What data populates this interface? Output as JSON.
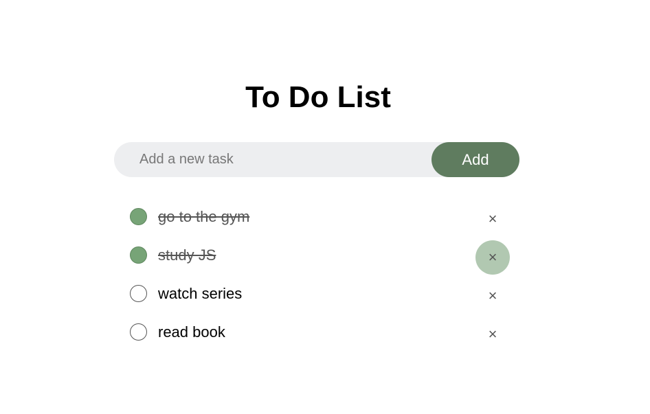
{
  "app": {
    "title": "To Do List"
  },
  "input": {
    "placeholder": "Add a new task",
    "value": ""
  },
  "add_button": {
    "label": "Add"
  },
  "tasks": [
    {
      "text": "go to the gym",
      "done": true
    },
    {
      "text": "study JS",
      "done": true
    },
    {
      "text": "watch series",
      "done": false
    },
    {
      "text": "read book",
      "done": false
    }
  ],
  "icons": {
    "delete": "×"
  },
  "colors": {
    "accent": "#5f7c5f",
    "checked": "#77a477",
    "hover": "#b1c8b1",
    "input_bg": "#edeef0"
  }
}
